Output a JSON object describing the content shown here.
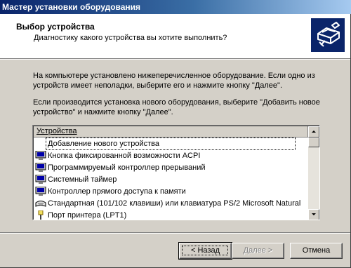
{
  "window": {
    "title": "Мастер установки оборудования"
  },
  "header": {
    "title": "Выбор устройства",
    "subtitle": "Диагностику какого устройства вы хотите выполнить?",
    "icon": "hardware-wizard-icon"
  },
  "body": {
    "paragraph1": "На компьютере установлено нижеперечисленное оборудование. Если одно из устройств имеет неполадки, выберите его и нажмите кнопку \"Далее\".",
    "paragraph2": "Если производится установка нового оборудования, выберите \"Добавить новое устройство\" и нажмите кнопку \"Далее\"."
  },
  "device_list": {
    "column_header": "Устройства",
    "items": [
      {
        "label": "Добавление нового устройства",
        "icon": "none",
        "selected": true
      },
      {
        "label": "Кнопка фиксированной возможности ACPI",
        "icon": "computer-icon",
        "selected": false
      },
      {
        "label": "Программируемый контроллер прерываний",
        "icon": "computer-icon",
        "selected": false
      },
      {
        "label": "Системный таймер",
        "icon": "computer-icon",
        "selected": false
      },
      {
        "label": "Контроллер прямого доступа к памяти",
        "icon": "computer-icon",
        "selected": false
      },
      {
        "label": "Стандартная (101/102 клавиши) или клавиатура PS/2 Microsoft Natural",
        "icon": "keyboard-icon",
        "selected": false
      },
      {
        "label": "Порт принтера (LPT1)",
        "icon": "printer-port-icon",
        "selected": false
      }
    ]
  },
  "buttons": {
    "back": "< Назад",
    "next": "Далее >",
    "cancel": "Отмена"
  },
  "colors": {
    "title_bar_start": "#0a246a",
    "title_bar_end": "#a6caf0",
    "dialog_face": "#d4d0c8"
  }
}
